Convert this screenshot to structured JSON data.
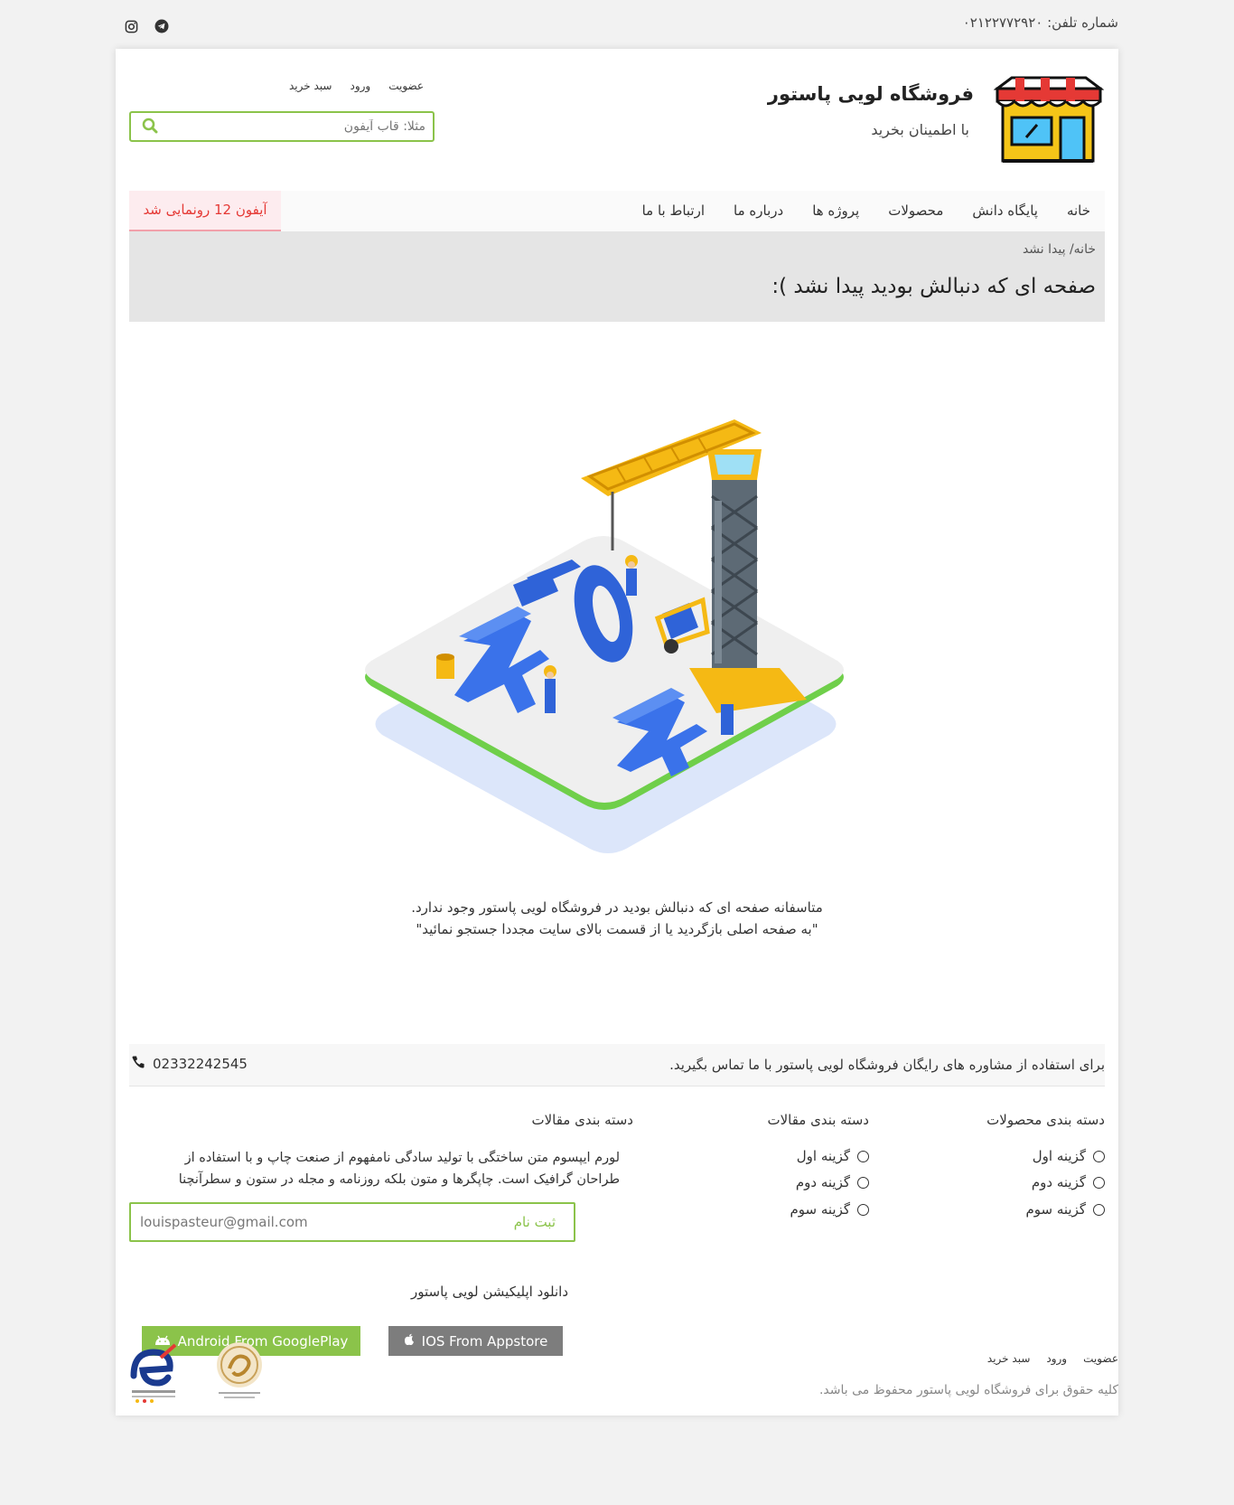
{
  "topbar": {
    "phone_label": "شماره تلفن: ۰۲۱۲۲۷۷۲۹۲۰",
    "icons": [
      "instagram-icon",
      "telegram-icon"
    ]
  },
  "header": {
    "title": "فروشگاه لویی پاستور",
    "subtitle": "با اطمینان بخرید",
    "links": {
      "signup": "عضویت",
      "login": "ورود",
      "cart": "سبد خرید"
    },
    "search": {
      "placeholder": "مثلا: قاب آیفون",
      "value": ""
    }
  },
  "nav": {
    "items": [
      "خانه",
      "پایگاه دانش",
      "محصولات",
      "پروژه ها",
      "درباره ما",
      "ارتباط با ما"
    ],
    "news": "آیفون 12 رونمایی شد"
  },
  "breadcrumb": {
    "path": "خانه/ پیدا نشد",
    "heading": "صفحه ای که دنبالش بودید پیدا نشد ):"
  },
  "notfound": {
    "line1": "متاسفانه صفحه ای که دنبالش بودید در فروشگاه لویی پاستور وجود ندارد.",
    "line2": "\"به صفحه اصلی بازگردید یا از قسمت بالای سایت مجددا جستجو نمائید\""
  },
  "contact": {
    "text": "برای استفاده از مشاوره های رایگان فروشگاه لویی پاستور با ما تماس بگیرید.",
    "phone": "02332242545"
  },
  "footer": {
    "col1": {
      "title": "دسته بندی محصولات",
      "options": [
        "گزینه اول",
        "گزینه دوم",
        "گزینه سوم"
      ]
    },
    "col2": {
      "title": "دسته بندی مقالات",
      "options": [
        "گزینه اول",
        "گزینه دوم",
        "گزینه سوم"
      ]
    },
    "col3": {
      "title": "دسته بندی مقالات",
      "lorem": "لورم ایپسوم متن ساختگی با تولید سادگی نامفهوم از صنعت چاپ و با استفاده از طراحان گرافیک است. چاپگرها و متون بلکه روزنامه و مجله در ستون و سطرآنچنا",
      "email": "louispasteur@gmail.com",
      "subscribe_label": "ثبت نام",
      "app_title": "دانلود اپلیکیشن لویی پاستور",
      "android_label": "Android From GooglePlay",
      "ios_label": "IOS From Appstore"
    },
    "bottom_links": {
      "signup": "عضویت",
      "login": "ورود",
      "cart": "سبد خرید"
    },
    "copyright": "کلیه حقوق برای فروشگاه لویی پاستور محفوظ می باشد."
  },
  "colors": {
    "accent": "#8bc34a",
    "news": "#e53935",
    "ios": "#7d7d7d"
  }
}
